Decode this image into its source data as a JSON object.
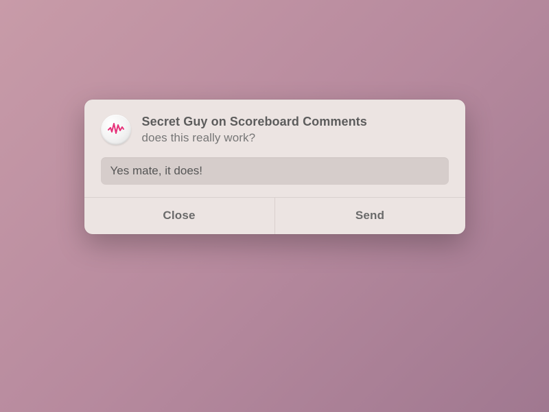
{
  "notification": {
    "title": "Secret Guy on Scoreboard Comments",
    "subtitle": "does this really work?",
    "reply_value": "Yes mate, it does!",
    "close_label": "Close",
    "send_label": "Send",
    "icon": "waveform-icon",
    "accent_color": "#e6327a"
  }
}
